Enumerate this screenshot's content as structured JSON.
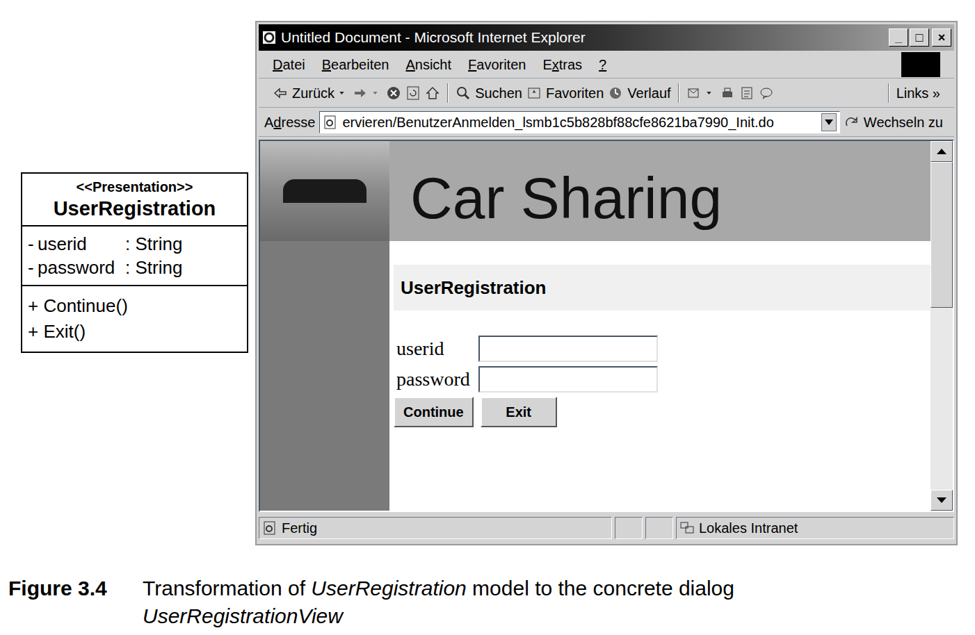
{
  "uml": {
    "stereotype": "<<Presentation>>",
    "name": "UserRegistration",
    "attributes": [
      {
        "visibility": "-",
        "name": "userid",
        "type": ": String"
      },
      {
        "visibility": "-",
        "name": "password",
        "type": ": String"
      }
    ],
    "operations": [
      "+ Continue()",
      "+ Exit()"
    ]
  },
  "window": {
    "title": "Untitled Document - Microsoft Internet Explorer",
    "controls": [
      "_",
      "□",
      "×"
    ]
  },
  "menu": [
    {
      "label": "Datei",
      "accel": 0
    },
    {
      "label": "Bearbeiten",
      "accel": 0
    },
    {
      "label": "Ansicht",
      "accel": 0
    },
    {
      "label": "Favoriten",
      "accel": 0
    },
    {
      "label": "Extras",
      "accel": 1
    },
    {
      "label": "?",
      "accel": 0
    }
  ],
  "toolbar": {
    "back": "Zurück",
    "search": "Suchen",
    "favorites": "Favoriten",
    "history": "Verlauf",
    "links": "Links »"
  },
  "address": {
    "label": "Adresse",
    "accel": 1,
    "value": "ervieren/BenutzerAnmelden_lsmb1c5b828bf88cfe8621ba7990_Init.do",
    "go": "Wechseln zu"
  },
  "page": {
    "banner": "Car Sharing",
    "heading": "UserRegistration",
    "fields": [
      {
        "label": "userid",
        "value": ""
      },
      {
        "label": "password",
        "value": ""
      }
    ],
    "buttons": [
      "Continue",
      "Exit"
    ]
  },
  "status_bar": {
    "text": "Fertig",
    "zone": "Lokales Intranet"
  },
  "caption": {
    "label": "Figure 3.4",
    "parts": [
      {
        "text": "Transformation of ",
        "italic": false
      },
      {
        "text": "UserRegistration",
        "italic": true
      },
      {
        "text": " model to the concrete dialog ",
        "italic": false
      },
      {
        "text": "UserRegistrationView",
        "italic": true
      }
    ]
  }
}
